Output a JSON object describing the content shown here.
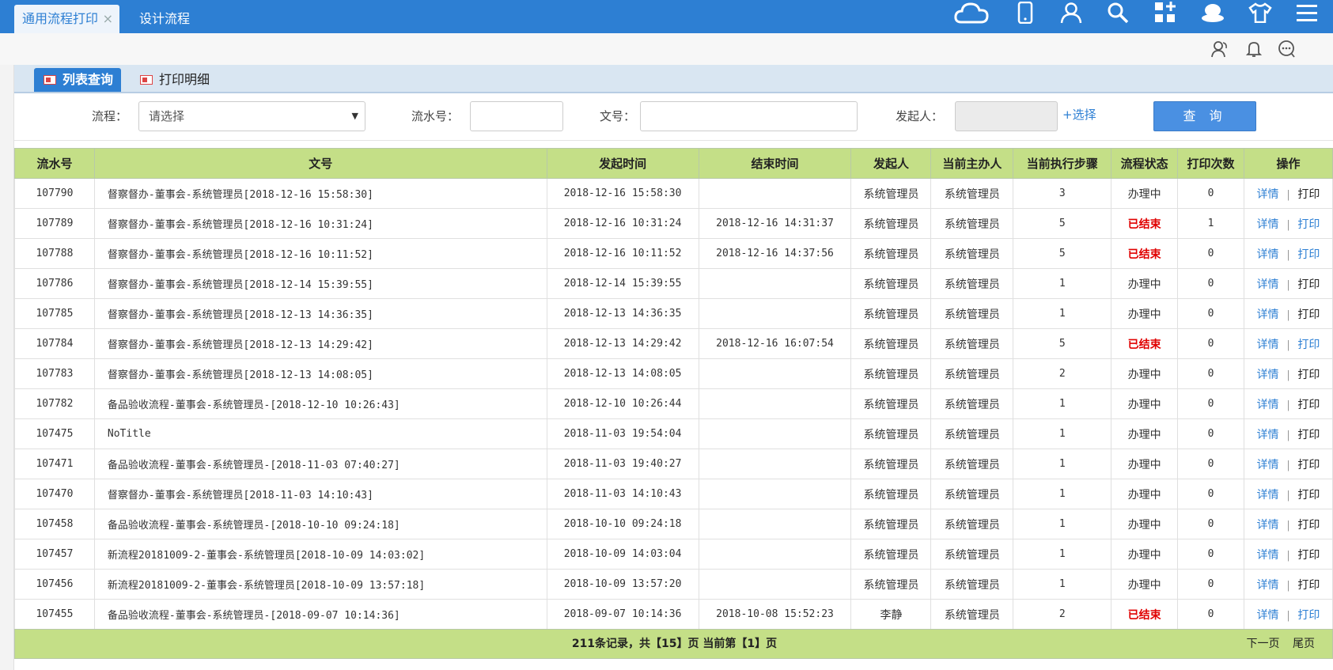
{
  "topbar": {
    "tabs": [
      {
        "label": "通用流程打印",
        "close": "×"
      },
      {
        "label": "设计流程"
      }
    ],
    "icons": [
      "cloud-icon",
      "phone-icon",
      "user-icon",
      "search-icon",
      "apps-icon",
      "hat-icon",
      "shirt-icon",
      "menu-icon"
    ]
  },
  "subbar": {
    "icons": [
      "contacts-icon",
      "bell-icon",
      "chat-icon"
    ]
  },
  "section_tabs": {
    "list_query": "列表查询",
    "print_detail": "打印明细"
  },
  "form": {
    "flow_label": "流程：",
    "flow_placeholder": "请选择",
    "serial_label": "流水号：",
    "serial_value": "",
    "docno_label": "文号：",
    "docno_value": "",
    "initiator_label": "发起人：",
    "initiator_value": "",
    "select_link": "+选择",
    "query_button": "查 询"
  },
  "table": {
    "headers": [
      "流水号",
      "文号",
      "发起时间",
      "结束时间",
      "发起人",
      "当前主办人",
      "当前执行步骤",
      "流程状态",
      "打印次数",
      "操作"
    ],
    "detail_label": "详情",
    "print_label": "打印",
    "rows": [
      {
        "id": "107790",
        "title": "督察督办-董事会-系统管理员[2018-12-16 15:58:30]",
        "start": "2018-12-16 15:58:30",
        "end": "",
        "initiator": "系统管理员",
        "handler": "系统管理员",
        "step": "3",
        "status": "办理中",
        "prints": "0"
      },
      {
        "id": "107789",
        "title": "督察督办-董事会-系统管理员[2018-12-16 10:31:24]",
        "start": "2018-12-16 10:31:24",
        "end": "2018-12-16 14:31:37",
        "initiator": "系统管理员",
        "handler": "系统管理员",
        "step": "5",
        "status": "已结束",
        "prints": "1"
      },
      {
        "id": "107788",
        "title": "督察督办-董事会-系统管理员[2018-12-16 10:11:52]",
        "start": "2018-12-16 10:11:52",
        "end": "2018-12-16 14:37:56",
        "initiator": "系统管理员",
        "handler": "系统管理员",
        "step": "5",
        "status": "已结束",
        "prints": "0"
      },
      {
        "id": "107786",
        "title": "督察督办-董事会-系统管理员[2018-12-14 15:39:55]",
        "start": "2018-12-14 15:39:55",
        "end": "",
        "initiator": "系统管理员",
        "handler": "系统管理员",
        "step": "1",
        "status": "办理中",
        "prints": "0"
      },
      {
        "id": "107785",
        "title": "督察督办-董事会-系统管理员[2018-12-13 14:36:35]",
        "start": "2018-12-13 14:36:35",
        "end": "",
        "initiator": "系统管理员",
        "handler": "系统管理员",
        "step": "1",
        "status": "办理中",
        "prints": "0"
      },
      {
        "id": "107784",
        "title": "督察督办-董事会-系统管理员[2018-12-13 14:29:42]",
        "start": "2018-12-13 14:29:42",
        "end": "2018-12-16 16:07:54",
        "initiator": "系统管理员",
        "handler": "系统管理员",
        "step": "5",
        "status": "已结束",
        "prints": "0"
      },
      {
        "id": "107783",
        "title": "督察督办-董事会-系统管理员[2018-12-13 14:08:05]",
        "start": "2018-12-13 14:08:05",
        "end": "",
        "initiator": "系统管理员",
        "handler": "系统管理员",
        "step": "2",
        "status": "办理中",
        "prints": "0"
      },
      {
        "id": "107782",
        "title": "备品验收流程-董事会-系统管理员-[2018-12-10 10:26:43]",
        "start": "2018-12-10 10:26:44",
        "end": "",
        "initiator": "系统管理员",
        "handler": "系统管理员",
        "step": "1",
        "status": "办理中",
        "prints": "0"
      },
      {
        "id": "107475",
        "title": "NoTitle",
        "start": "2018-11-03 19:54:04",
        "end": "",
        "initiator": "系统管理员",
        "handler": "系统管理员",
        "step": "1",
        "status": "办理中",
        "prints": "0"
      },
      {
        "id": "107471",
        "title": "备品验收流程-董事会-系统管理员-[2018-11-03 07:40:27]",
        "start": "2018-11-03 19:40:27",
        "end": "",
        "initiator": "系统管理员",
        "handler": "系统管理员",
        "step": "1",
        "status": "办理中",
        "prints": "0"
      },
      {
        "id": "107470",
        "title": "督察督办-董事会-系统管理员[2018-11-03 14:10:43]",
        "start": "2018-11-03 14:10:43",
        "end": "",
        "initiator": "系统管理员",
        "handler": "系统管理员",
        "step": "1",
        "status": "办理中",
        "prints": "0"
      },
      {
        "id": "107458",
        "title": "备品验收流程-董事会-系统管理员-[2018-10-10 09:24:18]",
        "start": "2018-10-10 09:24:18",
        "end": "",
        "initiator": "系统管理员",
        "handler": "系统管理员",
        "step": "1",
        "status": "办理中",
        "prints": "0"
      },
      {
        "id": "107457",
        "title": "新流程20181009-2-董事会-系统管理员[2018-10-09 14:03:02]",
        "start": "2018-10-09 14:03:04",
        "end": "",
        "initiator": "系统管理员",
        "handler": "系统管理员",
        "step": "1",
        "status": "办理中",
        "prints": "0"
      },
      {
        "id": "107456",
        "title": "新流程20181009-2-董事会-系统管理员[2018-10-09 13:57:18]",
        "start": "2018-10-09 13:57:20",
        "end": "",
        "initiator": "系统管理员",
        "handler": "系统管理员",
        "step": "1",
        "status": "办理中",
        "prints": "0"
      },
      {
        "id": "107455",
        "title": "备品验收流程-董事会-系统管理员-[2018-09-07 10:14:36]",
        "start": "2018-09-07 10:14:36",
        "end": "2018-10-08 15:52:23",
        "initiator": "李静",
        "handler": "系统管理员",
        "step": "2",
        "status": "已结束",
        "prints": "0"
      }
    ]
  },
  "footer": {
    "info": "211条记录，共【15】页 当前第【1】页",
    "next_page": "下一页",
    "last_page": "尾页"
  },
  "colors": {
    "brand": "#2d7fd3",
    "header_green": "#c4df87",
    "done_red": "#e00000"
  }
}
